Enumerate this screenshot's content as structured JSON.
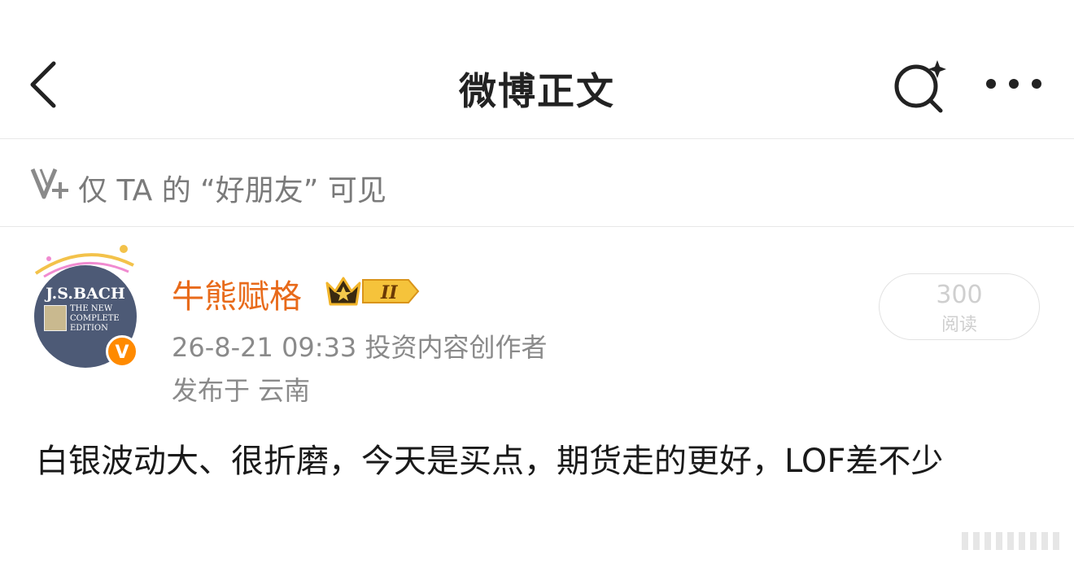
{
  "header": {
    "title": "微博正文"
  },
  "visibility": {
    "text": "仅 TA 的 “好朋友” 可见"
  },
  "post": {
    "avatar": {
      "title_line": "J.S.BACH",
      "sub_lines": [
        "THE NEW",
        "COMPLETE",
        "EDITION"
      ],
      "verified_badge": "V"
    },
    "author": "牛熊赋格",
    "level_badge": "II",
    "meta": "26-8-21 09:33  投资内容创作者",
    "location": "发布于 云南",
    "reads": {
      "count": "300",
      "label": "阅读"
    },
    "content": "白银波动大、很折磨，今天是买点，期货走的更好，LOF差不少"
  },
  "colors": {
    "author": "#e86a1a",
    "badge": "#ff8a00",
    "muted": "#8a8a8a"
  }
}
